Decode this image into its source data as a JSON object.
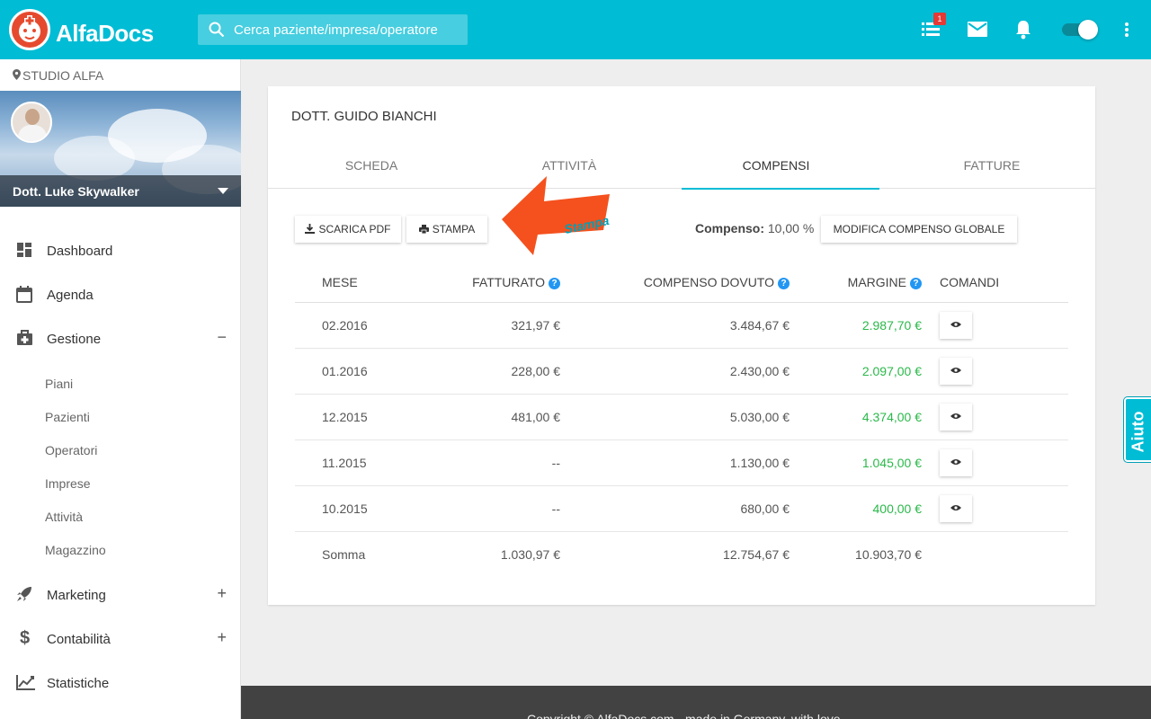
{
  "app": {
    "brand": "AlfaDocs"
  },
  "search": {
    "placeholder": "Cerca paziente/impresa/operatore"
  },
  "topbar": {
    "notification_count": "1"
  },
  "sidebar": {
    "studio": "STUDIO ALFA",
    "profile_name": "Dott. Luke Skywalker",
    "items": [
      {
        "label": "Dashboard",
        "icon": "dashboard-icon"
      },
      {
        "label": "Agenda",
        "icon": "calendar-icon"
      },
      {
        "label": "Gestione",
        "icon": "medical-bag-icon",
        "expander": "−"
      },
      {
        "label": "Marketing",
        "icon": "rocket-icon",
        "expander": "+"
      },
      {
        "label": "Contabilità",
        "icon": "dollar-icon",
        "expander": "+"
      },
      {
        "label": "Statistiche",
        "icon": "chart-line-icon"
      }
    ],
    "subitems": [
      "Piani",
      "Pazienti",
      "Operatori",
      "Imprese",
      "Attività",
      "Magazzino"
    ]
  },
  "card": {
    "title": "DOTT. GUIDO BIANCHI",
    "tabs": [
      "SCHEDA",
      "ATTIVITÀ",
      "COMPENSI",
      "FATTURE"
    ],
    "active_tab": "COMPENSI",
    "buttons": {
      "pdf": "SCARICA PDF",
      "print": "STAMPA",
      "global": "MODIFICA COMPENSO GLOBALE"
    },
    "compenso_label": "Compenso:",
    "compenso_value": "10,00 %",
    "annotation": "Stampa"
  },
  "table": {
    "headers": {
      "mese": "MESE",
      "fatturato": "FATTURATO",
      "compenso": "COMPENSO DOVUTO",
      "margine": "MARGINE",
      "comandi": "COMANDI"
    },
    "rows": [
      {
        "mese": "02.2016",
        "fatturato": "321,97 €",
        "compenso": "3.484,67 €",
        "margine": "2.987,70 €"
      },
      {
        "mese": "01.2016",
        "fatturato": "228,00 €",
        "compenso": "2.430,00 €",
        "margine": "2.097,00 €"
      },
      {
        "mese": "12.2015",
        "fatturato": "481,00 €",
        "compenso": "5.030,00 €",
        "margine": "4.374,00 €"
      },
      {
        "mese": "11.2015",
        "fatturato": "--",
        "compenso": "1.130,00 €",
        "margine": "1.045,00 €"
      },
      {
        "mese": "10.2015",
        "fatturato": "--",
        "compenso": "680,00 €",
        "margine": "400,00 €"
      }
    ],
    "sum": {
      "mese": "Somma",
      "fatturato": "1.030,97 €",
      "compenso": "12.754,67 €",
      "margine": "10.903,70 €"
    }
  },
  "footer": {
    "text": "Copyright © AlfaDocs.com - made in Germany, with love"
  },
  "help_tab": {
    "label": "Aiuto"
  },
  "colors": {
    "primary": "#00bcd4",
    "accent_arrow": "#f4511e",
    "positive": "#2bb84a",
    "info": "#2196f3"
  }
}
